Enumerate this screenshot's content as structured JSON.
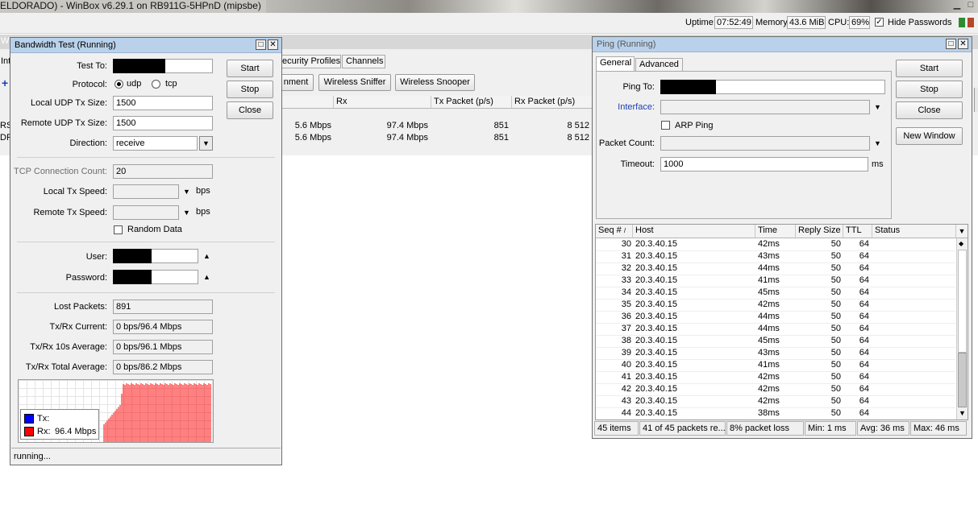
{
  "app": {
    "title": "ELDORADO) - WinBox v6.29.1 on RB911G-5HPnD (mipsbe)",
    "uptime_label": "Uptime:",
    "uptime": "07:52:49",
    "memory_label": "Memory:",
    "memory": "43.6 MiB",
    "cpu_label": "CPU:",
    "cpu": "69%",
    "hide_passwords_label": "Hide Passwords",
    "hide_passwords_checked": true
  },
  "background": {
    "left_cut": [
      "Wi",
      "Int",
      "RS",
      "DF"
    ],
    "tabs": [
      "ecurity Profiles",
      "Channels"
    ],
    "buttons": [
      "nment",
      "Wireless Sniffer",
      "Wireless Snooper"
    ],
    "columns": [
      "Rx",
      "Tx Packet (p/s)",
      "Rx Packet (p/s)"
    ],
    "rows": [
      {
        "tx": "5.6 Mbps",
        "rx": "97.4 Mbps",
        "txp": "851",
        "rxp": "8 512"
      },
      {
        "tx": "5.6 Mbps",
        "rx": "97.4 Mbps",
        "txp": "851",
        "rxp": "8 512"
      }
    ]
  },
  "bandwidth": {
    "title": "Bandwidth Test (Running)",
    "test_to_label": "Test To:",
    "protocol_label": "Protocol:",
    "udp_label": "udp",
    "tcp_label": "tcp",
    "local_udp_label": "Local UDP Tx Size:",
    "local_udp": "1500",
    "remote_udp_label": "Remote UDP Tx Size:",
    "remote_udp": "1500",
    "direction_label": "Direction:",
    "direction": "receive",
    "tcp_count_label": "TCP Connection Count:",
    "tcp_count": "20",
    "local_tx_label": "Local Tx Speed:",
    "remote_tx_label": "Remote Tx Speed:",
    "bps": "bps",
    "random_data_label": "Random Data",
    "user_label": "User:",
    "password_label": "Password:",
    "lost_label": "Lost Packets:",
    "lost": "891",
    "current_label": "Tx/Rx Current:",
    "current": "0 bps/96.4 Mbps",
    "avg10_label": "Tx/Rx 10s Average:",
    "avg10": "0 bps/96.1 Mbps",
    "total_label": "Tx/Rx Total Average:",
    "total": "0 bps/86.2 Mbps",
    "legend_tx": "Tx:",
    "legend_rx": "Rx:",
    "legend_rx_value": "96.4 Mbps",
    "tx_color": "#0000ff",
    "rx_color": "#ff0000",
    "buttons": {
      "start": "Start",
      "stop": "Stop",
      "close": "Close"
    },
    "status": "running..."
  },
  "ping": {
    "title": "Ping (Running)",
    "tab_general": "General",
    "tab_advanced": "Advanced",
    "ping_to_label": "Ping To:",
    "interface_label": "Interface:",
    "arp_label": "ARP Ping",
    "count_label": "Packet Count:",
    "timeout_label": "Timeout:",
    "timeout": "1000",
    "ms": "ms",
    "buttons": {
      "start": "Start",
      "stop": "Stop",
      "close": "Close",
      "new_window": "New Window"
    },
    "columns": [
      "Seq #",
      "Host",
      "Time",
      "Reply Size",
      "TTL",
      "Status"
    ],
    "rows": [
      {
        "seq": "30",
        "host": "20.3.40.15",
        "time": "42ms",
        "size": "50",
        "ttl": "64"
      },
      {
        "seq": "31",
        "host": "20.3.40.15",
        "time": "43ms",
        "size": "50",
        "ttl": "64"
      },
      {
        "seq": "32",
        "host": "20.3.40.15",
        "time": "44ms",
        "size": "50",
        "ttl": "64"
      },
      {
        "seq": "33",
        "host": "20.3.40.15",
        "time": "41ms",
        "size": "50",
        "ttl": "64"
      },
      {
        "seq": "34",
        "host": "20.3.40.15",
        "time": "45ms",
        "size": "50",
        "ttl": "64"
      },
      {
        "seq": "35",
        "host": "20.3.40.15",
        "time": "42ms",
        "size": "50",
        "ttl": "64"
      },
      {
        "seq": "36",
        "host": "20.3.40.15",
        "time": "44ms",
        "size": "50",
        "ttl": "64"
      },
      {
        "seq": "37",
        "host": "20.3.40.15",
        "time": "44ms",
        "size": "50",
        "ttl": "64"
      },
      {
        "seq": "38",
        "host": "20.3.40.15",
        "time": "45ms",
        "size": "50",
        "ttl": "64"
      },
      {
        "seq": "39",
        "host": "20.3.40.15",
        "time": "43ms",
        "size": "50",
        "ttl": "64"
      },
      {
        "seq": "40",
        "host": "20.3.40.15",
        "time": "41ms",
        "size": "50",
        "ttl": "64"
      },
      {
        "seq": "41",
        "host": "20.3.40.15",
        "time": "42ms",
        "size": "50",
        "ttl": "64"
      },
      {
        "seq": "42",
        "host": "20.3.40.15",
        "time": "42ms",
        "size": "50",
        "ttl": "64"
      },
      {
        "seq": "43",
        "host": "20.3.40.15",
        "time": "42ms",
        "size": "50",
        "ttl": "64"
      },
      {
        "seq": "44",
        "host": "20.3.40.15",
        "time": "38ms",
        "size": "50",
        "ttl": "64"
      }
    ],
    "status_items": "45 items",
    "status_packets": "41 of 45 packets re...",
    "status_loss": "8% packet loss",
    "status_min": "Min: 1 ms",
    "status_avg": "Avg: 36 ms",
    "status_max": "Max: 46 ms"
  }
}
